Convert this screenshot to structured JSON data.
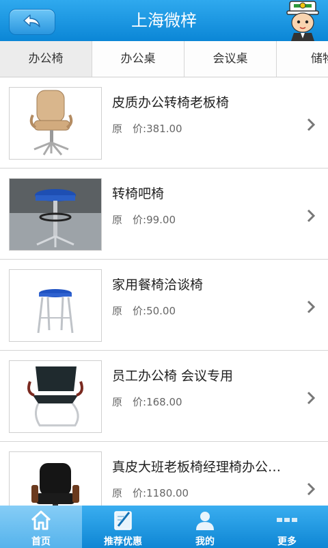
{
  "header": {
    "title": "上海微梓",
    "back_icon": "back-arrow-icon",
    "mascot": "mascot-avatar"
  },
  "tabs": [
    {
      "label": "办公椅",
      "active": true
    },
    {
      "label": "办公桌",
      "active": false
    },
    {
      "label": "会议桌",
      "active": false
    },
    {
      "label": "储物",
      "active": false
    }
  ],
  "products": [
    {
      "name": "皮质办公转椅老板椅",
      "price_label": "原　价:",
      "price": "381.00",
      "image": "beige-leather-office-chair"
    },
    {
      "name": "转椅吧椅",
      "price_label": "原　价:",
      "price": "99.00",
      "image": "blue-bar-stool"
    },
    {
      "name": "家用餐椅洽谈椅",
      "price_label": "原　价:",
      "price": "50.00",
      "image": "blue-round-stool"
    },
    {
      "name": "员工办公椅 会议专用",
      "price_label": "原　价:",
      "price": "168.00",
      "image": "black-mesh-conference-chair"
    },
    {
      "name": "真皮大班老板椅经理椅办公…",
      "price_label": "原　价:",
      "price": "1180.00",
      "image": "black-leather-executive-chair"
    }
  ],
  "bottom_nav": [
    {
      "label": "首页",
      "icon": "home-icon",
      "active": true
    },
    {
      "label": "推荐优惠",
      "icon": "recommend-icon",
      "active": false
    },
    {
      "label": "我的",
      "icon": "user-icon",
      "active": false
    },
    {
      "label": "更多",
      "icon": "more-icon",
      "active": false
    }
  ],
  "colors": {
    "header": "#1a97e2",
    "nav": "#1a97e2",
    "nav_active": "#6cc0f2"
  }
}
